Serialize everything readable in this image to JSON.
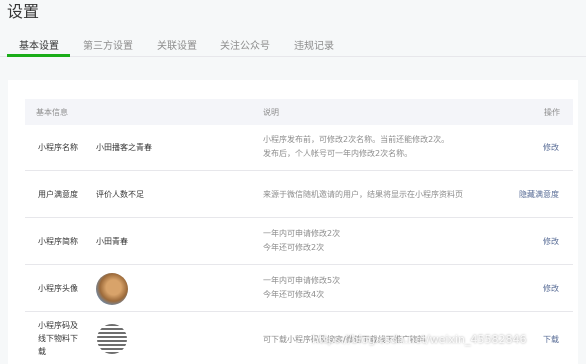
{
  "title": "设置",
  "tabs": [
    {
      "label": "基本设置"
    },
    {
      "label": "第三方设置"
    },
    {
      "label": "关联设置"
    },
    {
      "label": "关注公众号"
    },
    {
      "label": "违规记录"
    }
  ],
  "table": {
    "headers": {
      "info": "基本信息",
      "desc": "说明",
      "op": "操作"
    },
    "rows": [
      {
        "label": "小程序名称",
        "value": "小田播客之青春",
        "desc1": "小程序发布前，可修改2次名称。当前还能修改2次。",
        "desc2": "发布后，个人帐号可一年内修改2次名称。",
        "op": "修改"
      },
      {
        "label": "用户满意度",
        "value": "评价人数不足",
        "desc1": "来源于微信随机邀请的用户，结果将显示在小程序资料页",
        "op": "隐藏满意度"
      },
      {
        "label": "小程序简称",
        "value": "小田青春",
        "desc1": "一年内可申请修改2次",
        "desc2": "今年还可修改2次",
        "op": "修改"
      },
      {
        "label": "小程序头像",
        "desc1": "一年内可申请修改5次",
        "desc2": "今年还可修改4次",
        "op": "修改"
      },
      {
        "label1": "小程序码及",
        "label2": "线下物料下",
        "label3": "载",
        "desc1": "可下载小程序码及搜索/微信下载线下推广物料",
        "op": "下载"
      }
    ]
  },
  "watermark": "https://blog.csdn.net/weixin_45582846"
}
